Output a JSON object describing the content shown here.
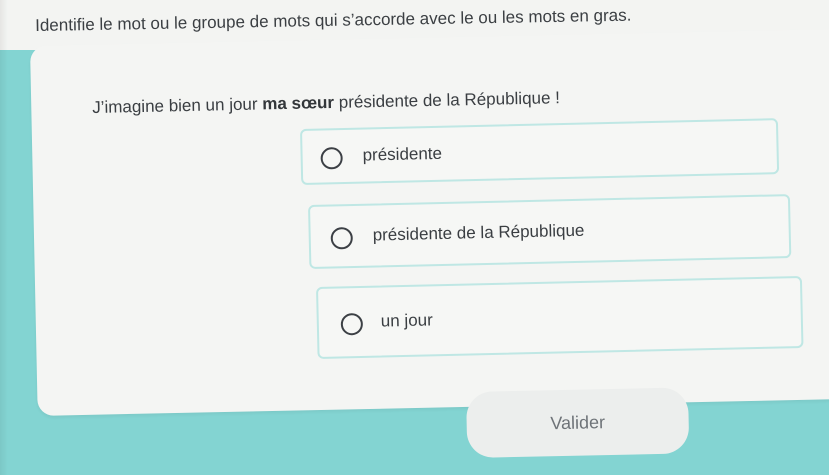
{
  "instruction": "Identifie le mot ou le groupe de mots qui s’accorde avec le ou les mots en gras.",
  "question": {
    "before": "J’imagine bien un jour ",
    "bold": "ma sœur",
    "after": " présidente de la République !"
  },
  "options": [
    {
      "label": "présidente",
      "selected": false
    },
    {
      "label": "présidente de la République",
      "selected": false
    },
    {
      "label": "un jour",
      "selected": false
    }
  ],
  "validate_label": "Valider",
  "colors": {
    "background": "#83d4d2",
    "card": "#f4f5f3",
    "option_border": "#bfe7e4",
    "button": "#eceeed",
    "text": "#3a3e42"
  }
}
